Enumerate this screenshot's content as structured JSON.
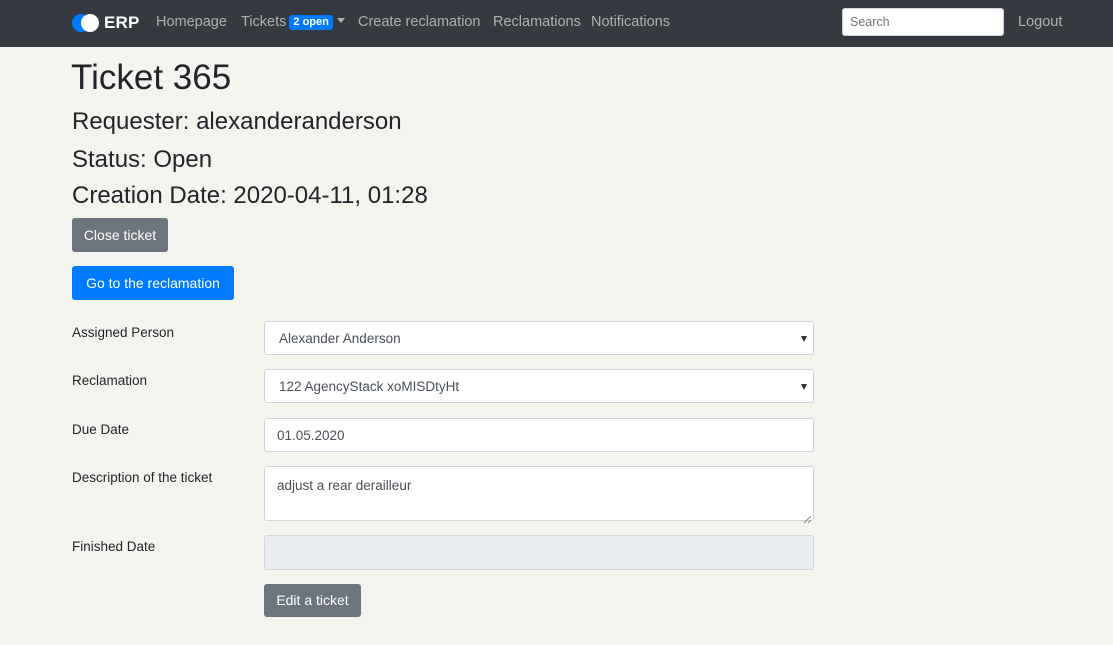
{
  "nav": {
    "brand": "ERP",
    "links": {
      "homepage": "Homepage",
      "tickets": "Tickets",
      "tickets_badge": "2 open",
      "create_reclamation": "Create reclamation",
      "reclamations": "Reclamations",
      "notifications": "Notifications",
      "logout": "Logout"
    },
    "search_placeholder": "Search"
  },
  "ticket": {
    "title": "Ticket 365",
    "requester": "Requester: alexanderanderson",
    "status": "Status: Open",
    "creation_date": "Creation Date: 2020-04-11, 01:28"
  },
  "actions": {
    "close_ticket": "Close ticket",
    "go_to_reclamation": "Go to the reclamation",
    "edit_ticket": "Edit a ticket"
  },
  "form": {
    "assigned_person": {
      "label": "Assigned Person",
      "value": "Alexander Anderson"
    },
    "reclamation": {
      "label": "Reclamation",
      "value": "122 AgencyStack xoMISDtyHt"
    },
    "due_date": {
      "label": "Due Date",
      "value": "01.05.2020"
    },
    "description": {
      "label": "Description of the ticket",
      "value": "adjust a rear derailleur"
    },
    "finished_date": {
      "label": "Finished Date",
      "value": ""
    }
  },
  "colors": {
    "navbar": "#343a40",
    "primary": "#007bff",
    "secondary": "#6c757d",
    "page_background": "#f4f4ef"
  }
}
